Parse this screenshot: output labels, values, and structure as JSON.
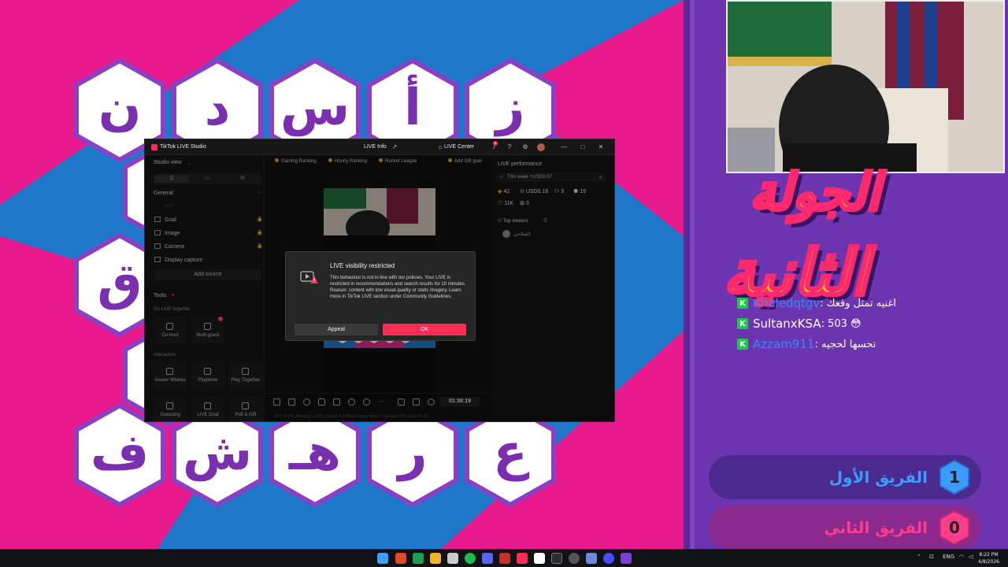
{
  "board": {
    "colors": {
      "pink": "#e8198d",
      "blue": "#1f77c9",
      "hex_fill": "#ffffff",
      "hex_border": "#8a3fc4",
      "letter": "#7a2fb0"
    },
    "top_row": [
      "ز",
      "أ",
      "س",
      "د",
      "ن"
    ],
    "left_col": [
      "ق"
    ],
    "bottom_row": [
      "ع",
      "ر",
      "هـ",
      "ش",
      "ف"
    ]
  },
  "round_title": {
    "line1": "الجولة",
    "line2": "الثانية"
  },
  "chat": [
    {
      "badge": "K",
      "name": "Khaledqtgv",
      "message": ": اغنيه تمثل وقعك"
    },
    {
      "badge": "K",
      "name": "SultanxKSA",
      "message": ": 503 😳"
    },
    {
      "badge": "K",
      "name": "Azzam911",
      "message": ": تحسها لحجيه"
    }
  ],
  "teams": [
    {
      "name": "الفريق الأول",
      "score": "1",
      "color": "#3b9cff"
    },
    {
      "name": "الفريق الثاني",
      "score": "0",
      "color": "#ff3d8b"
    }
  ],
  "studio": {
    "app_title": "TikTok LIVE Studio",
    "center_title": "LIVE Info",
    "live_center": "LIVE Center",
    "notification_count": "6",
    "left": {
      "studio_view": "Studio view",
      "general": "General",
      "alert": "Alert",
      "items": [
        "Goal",
        "Image",
        "Camera",
        "Display capture"
      ],
      "add_source": "Add source",
      "tools": "Tools",
      "go_live_together": "Go LIVE together",
      "cohost": "Co-host",
      "multiguest": "Multi-guest",
      "multiguest_badge": "1",
      "interaction": "Interaction",
      "viewer_wishes": "Viewer Wishes",
      "playbook": "Playbook",
      "play_together": "Play Together",
      "guessing": "Guessing",
      "live_goal": "LIVE Goal",
      "poll_gift": "Poll & Gift"
    },
    "chips": [
      "Gaming Ranking",
      "Hourly Ranking",
      "Rocket League",
      "Add Gift goal"
    ],
    "timer": "01:38:19",
    "stats": "CPU: 3.13%    Memory: 1.93%    Upload: 5.8 Mbps    Frame drops: 0    Encode FPS: 60    FPS: 60",
    "right": {
      "title": "LIVE performance",
      "week": "This week +USD0.07",
      "m1": "42",
      "m2": "USD0.16",
      "m3": "3",
      "m4": "19",
      "m5": "11K",
      "m6": "3",
      "top_viewers": "Top viewers",
      "viewer_name": "الشلاحي"
    },
    "modal": {
      "title": "LIVE visibility restricted",
      "body": "This behaviour is not in line with our policies. Your LIVE is restricted in recommendations and search results for 10 minutes. Reason: content with low visual quality or static imagery. Learn more in TikTok LIVE section under Community Guidelines.",
      "appeal": "Appeal",
      "ok": "OK"
    }
  },
  "taskbar": {
    "lang": "ENG",
    "time": "8:22 PM",
    "date": "4/8/2026"
  }
}
